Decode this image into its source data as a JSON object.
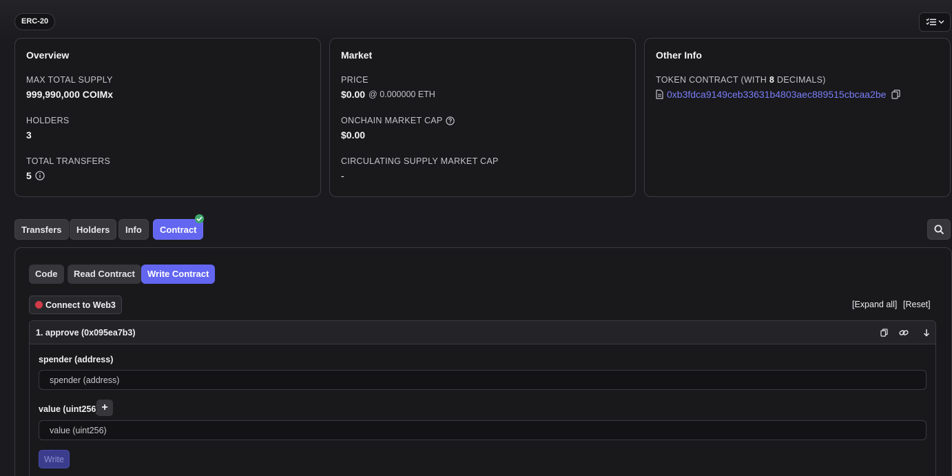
{
  "token_standard": "ERC-20",
  "overview": {
    "title": "Overview",
    "max_supply_label": "MAX TOTAL SUPPLY",
    "max_supply_value": "999,990,000 COIMx",
    "holders_label": "HOLDERS",
    "holders_value": "3",
    "transfers_label": "TOTAL TRANSFERS",
    "transfers_value": "5"
  },
  "market": {
    "title": "Market",
    "price_label": "PRICE",
    "price_value": "$0.00",
    "price_eth": "@ 0.000000 ETH",
    "mcap_label": "ONCHAIN MARKET CAP",
    "mcap_value": "$0.00",
    "circ_label": "CIRCULATING SUPPLY MARKET CAP",
    "circ_value": "-"
  },
  "other_info": {
    "title": "Other Info",
    "contract_label_pre": "TOKEN CONTRACT (WITH ",
    "contract_decimals": "8",
    "contract_label_post": " DECIMALS)",
    "contract_address": "0xb3fdca9149ceb33631b4803aec889515cbcaa2be"
  },
  "tabs": [
    "Transfers",
    "Holders",
    "Info",
    "Contract"
  ],
  "active_tab": "Contract",
  "subtabs": [
    "Code",
    "Read Contract",
    "Write Contract"
  ],
  "active_subtab": "Write Contract",
  "connect_label": "Connect to Web3",
  "expand_all": "[Expand all]",
  "reset": "[Reset]",
  "function": {
    "title": "1. approve (0x095ea7b3)",
    "fields": [
      {
        "label": "spender (address)",
        "placeholder": "spender (address)"
      },
      {
        "label": "value (uint256)",
        "placeholder": "value (uint256)"
      }
    ],
    "plus": "+",
    "write_label": "Write"
  },
  "colors": {
    "accent": "#6366f1",
    "link": "#7a7ef7",
    "status_disconnected": "#d23b48",
    "verified": "#3ea66b"
  }
}
